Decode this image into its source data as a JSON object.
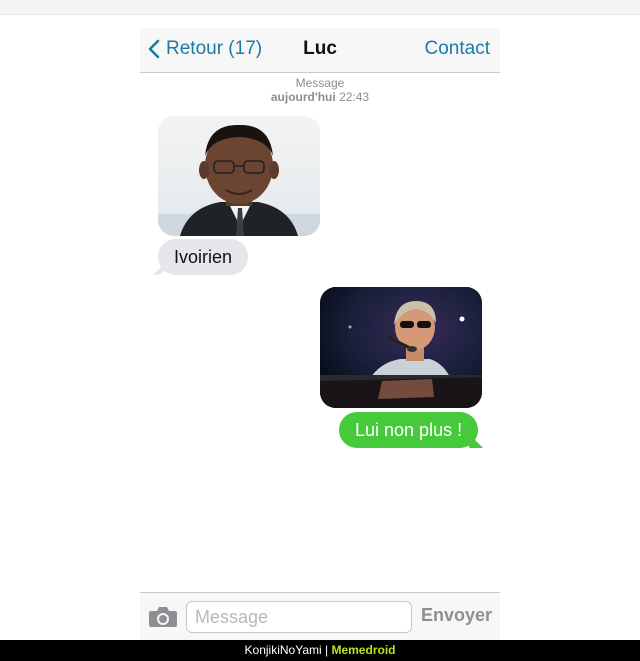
{
  "nav": {
    "back_label": "Retour (17)",
    "title": "Luc",
    "contact_label": "Contact"
  },
  "thread": {
    "service_label": "Message",
    "timestamp_date": "aujourd'hui",
    "timestamp_time": "22:43"
  },
  "messages": [
    {
      "direction": "incoming",
      "type": "photo",
      "icon": "man-portrait-photo"
    },
    {
      "direction": "incoming",
      "type": "text",
      "text": "Ivoirien"
    },
    {
      "direction": "outgoing",
      "type": "photo",
      "icon": "singer-at-piano-photo"
    },
    {
      "direction": "outgoing",
      "type": "text",
      "text": "Lui non plus !"
    }
  ],
  "composer": {
    "placeholder": "Message",
    "value": "",
    "send_label": "Envoyer",
    "camera_icon": "camera-icon"
  },
  "footer": {
    "author": "KonjikiNoYami",
    "separator": "|",
    "brand": "Memedroid"
  },
  "colors": {
    "ios_blue": "#1a7ba6",
    "incoming_bubble": "#e5e5ea",
    "outgoing_bubble": "#46c93a",
    "footer_brand": "#b5e61d"
  }
}
